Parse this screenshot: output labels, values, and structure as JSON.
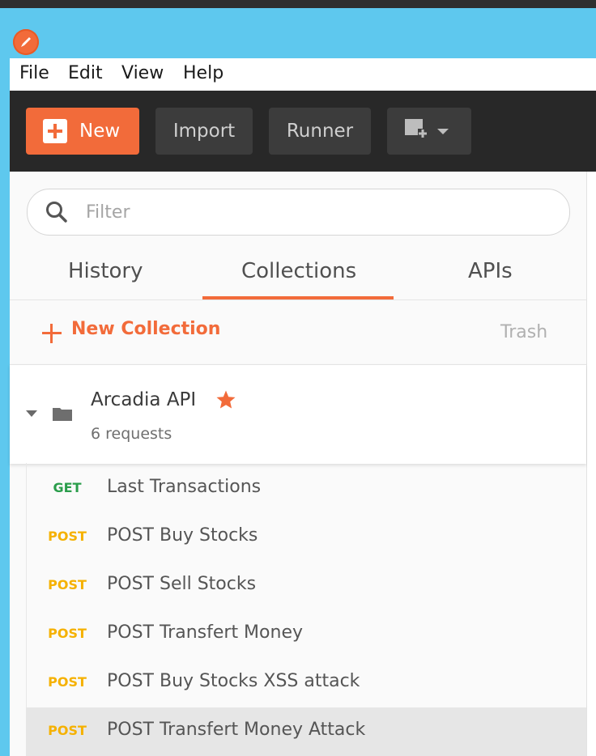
{
  "menu": [
    "File",
    "Edit",
    "View",
    "Help"
  ],
  "toolbar": {
    "new_label": "New",
    "import_label": "Import",
    "runner_label": "Runner"
  },
  "filter": {
    "placeholder": "Filter"
  },
  "tabs": [
    "History",
    "Collections",
    "APIs"
  ],
  "active_tab": "Collections",
  "collections_bar": {
    "new_collection_label": "New Collection",
    "trash_label": "Trash"
  },
  "collection": {
    "name": "Arcadia API",
    "starred": true,
    "count_label": "6 requests"
  },
  "requests": [
    {
      "method": "GET",
      "name": "Last Transactions"
    },
    {
      "method": "POST",
      "name": "POST Buy Stocks"
    },
    {
      "method": "POST",
      "name": "POST Sell Stocks"
    },
    {
      "method": "POST",
      "name": "POST Transfert Money"
    },
    {
      "method": "POST",
      "name": "POST Buy Stocks XSS attack"
    },
    {
      "method": "POST",
      "name": "POST Transfert Money Attack"
    }
  ],
  "selected_request_index": 5,
  "colors": {
    "accent": "#f26b3a",
    "get": "#2a9d4b",
    "post": "#f5b100",
    "titlebar": "#5ec8ee",
    "toolbar": "#282828"
  }
}
